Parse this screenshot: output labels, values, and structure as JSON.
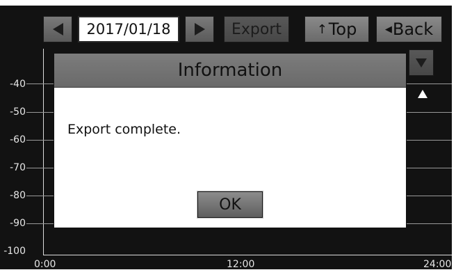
{
  "toolbar": {
    "date": "2017/01/18",
    "export_label": "Export",
    "top_label": "Top",
    "back_label": "Back",
    "icons": {
      "prev": "triangle-left-icon",
      "next": "triangle-right-icon",
      "top": "arrow-up-icon",
      "back": "triangle-left-icon",
      "scroll_down": "triangle-down-icon",
      "scroll_up": "triangle-up-icon"
    }
  },
  "chart": {
    "y_ticks": [
      "-40",
      "-50",
      "-60",
      "-70",
      "-80",
      "-90",
      "-100"
    ],
    "x_ticks": [
      "0:00",
      "12:00",
      "24:00"
    ]
  },
  "dialog": {
    "title": "Information",
    "message": "Export complete.",
    "ok_label": "OK"
  }
}
